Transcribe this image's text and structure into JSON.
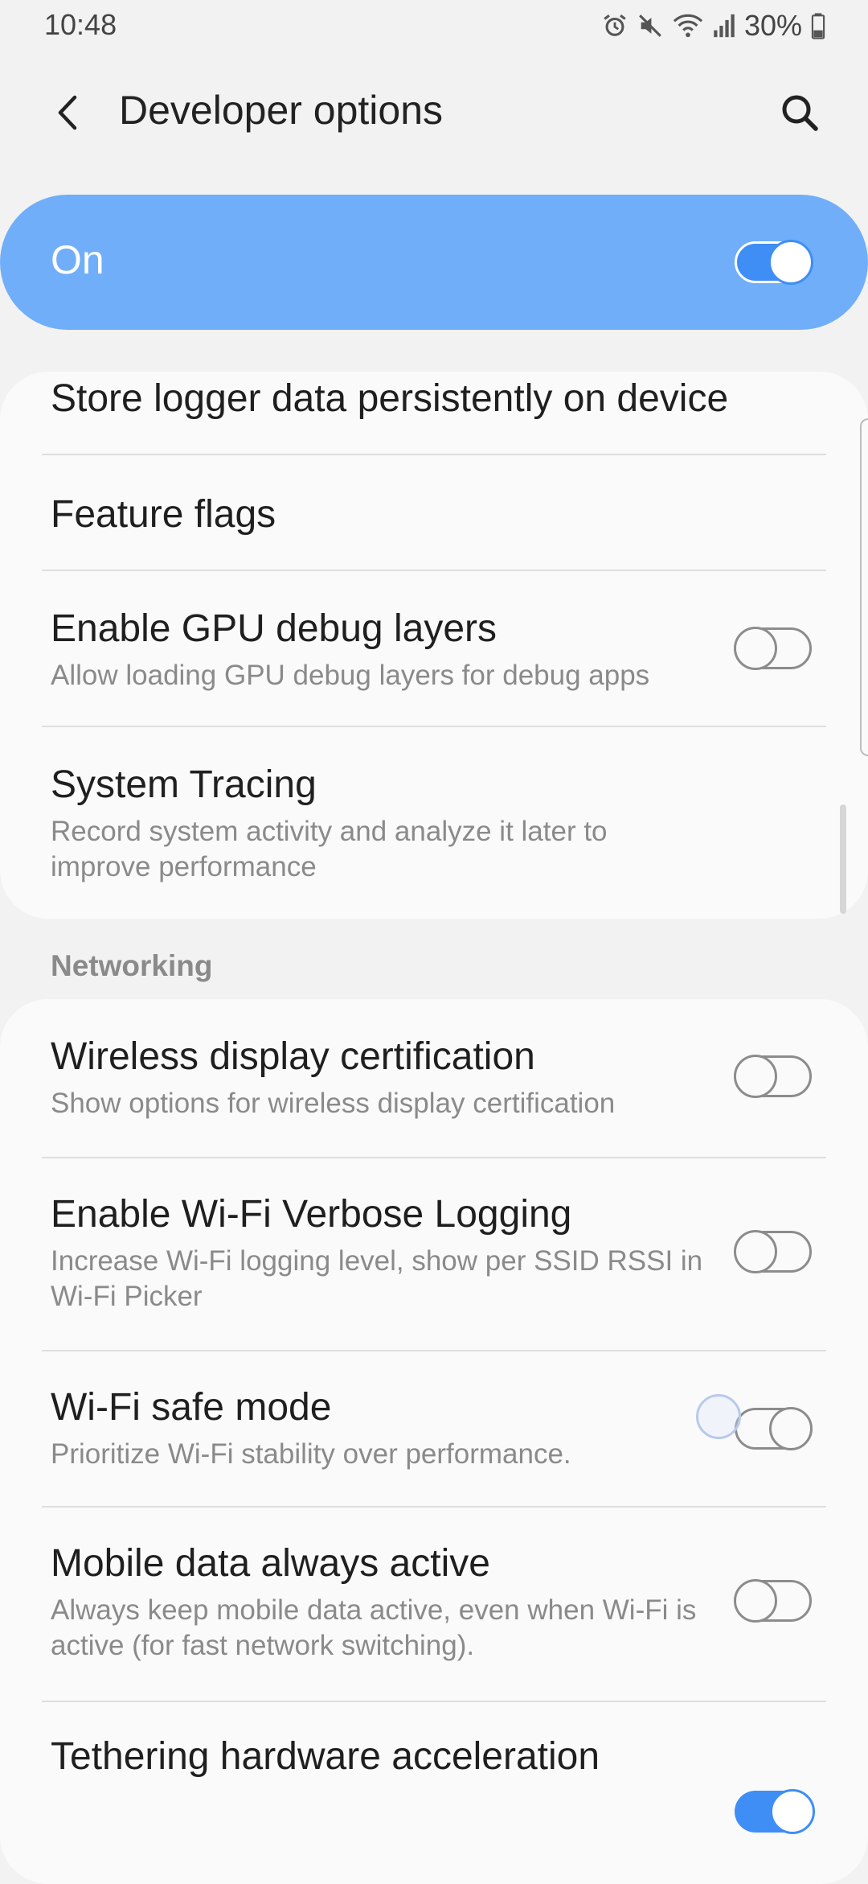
{
  "status_bar": {
    "time": "10:48",
    "battery": "30%",
    "icons": [
      "alarm-icon",
      "mute-icon",
      "wifi-icon",
      "signal-icon",
      "battery-icon"
    ]
  },
  "header": {
    "title": "Developer options",
    "back_icon": "back-arrow-icon",
    "search_icon": "search-icon"
  },
  "master_switch": {
    "label": "On",
    "checked": true,
    "color": "#70aef9"
  },
  "debugging_items": [
    {
      "title": "Store logger data persistently on device"
    },
    {
      "title": "Feature flags"
    },
    {
      "title": "Enable GPU debug layers",
      "subtitle": "Allow loading GPU debug layers for debug apps",
      "toggle": false
    },
    {
      "title": "System Tracing",
      "subtitle": "Record system activity and analyze it later to improve performance"
    }
  ],
  "networking": {
    "header": "Networking",
    "items": [
      {
        "title": "Wireless display certification",
        "subtitle": "Show options for wireless display certification",
        "toggle": false
      },
      {
        "title": "Enable Wi-Fi Verbose Logging",
        "subtitle": "Increase Wi-Fi logging level, show per SSID RSSI in Wi-Fi Picker",
        "toggle": false
      },
      {
        "title": "Wi-Fi safe mode",
        "subtitle": "Prioritize Wi-Fi stability over performance.",
        "toggle": false
      },
      {
        "title": "Mobile data always active",
        "subtitle": "Always keep mobile data active, even when Wi-Fi is active (for fast network switching).",
        "toggle": false
      },
      {
        "title": "Tethering hardware acceleration",
        "toggle": true
      }
    ]
  },
  "colors": {
    "accent": "#3e8ef6",
    "background": "#f2f2f2",
    "card": "#fafafa",
    "secondary_text": "#8a8a8a"
  }
}
